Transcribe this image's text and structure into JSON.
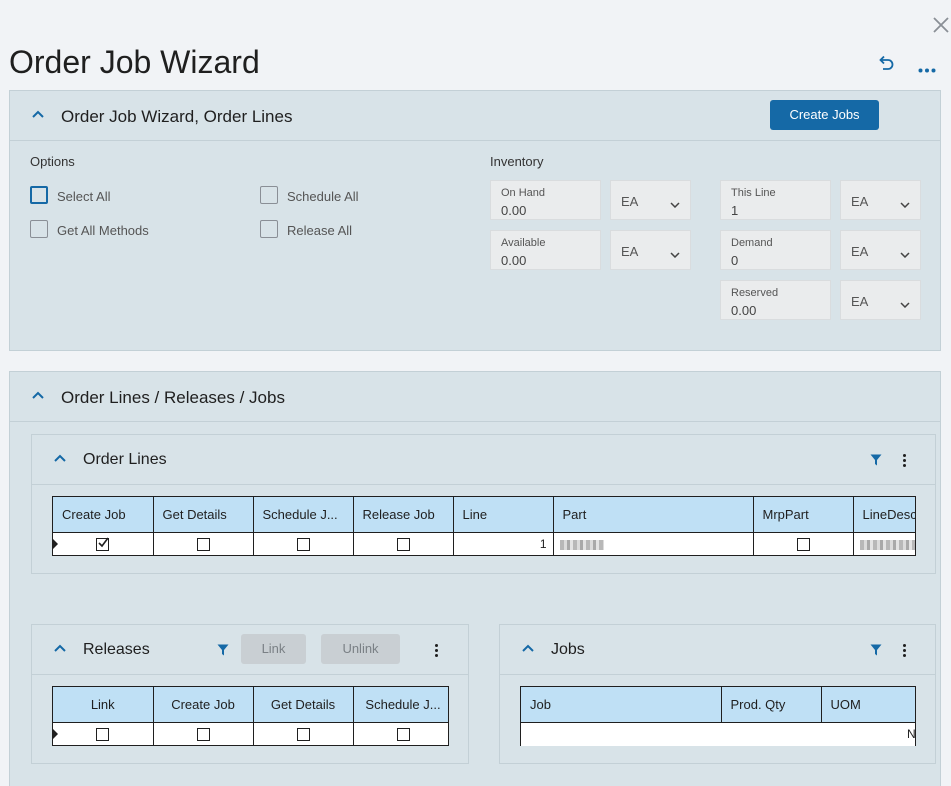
{
  "window": {
    "title": "Order Job Wizard"
  },
  "wizard_panel": {
    "title": "Order Job Wizard, Order Lines",
    "create_jobs_label": "Create Jobs",
    "options": {
      "heading": "Options",
      "select_all": "Select All",
      "schedule_all": "Schedule All",
      "get_all_methods": "Get All Methods",
      "release_all": "Release All"
    },
    "inventory": {
      "heading": "Inventory",
      "on_hand": {
        "label": "On Hand",
        "value": "0.00",
        "uom": "EA"
      },
      "available": {
        "label": "Available",
        "value": "0.00",
        "uom": "EA"
      },
      "this_line": {
        "label": "This Line",
        "value": "1",
        "uom": "EA"
      },
      "demand": {
        "label": "Demand",
        "value": "0",
        "uom": "EA"
      },
      "reserved": {
        "label": "Reserved",
        "value": "0.00",
        "uom": "EA"
      }
    }
  },
  "lines_panel": {
    "title": "Order Lines / Releases / Jobs",
    "order_lines": {
      "title": "Order Lines",
      "columns": [
        "Create Job",
        "Get Details",
        "Schedule J...",
        "Release Job",
        "Line",
        "Part",
        "MrpPart",
        "LineDesc"
      ],
      "row": {
        "line": "1"
      }
    },
    "releases": {
      "title": "Releases",
      "link_label": "Link",
      "unlink_label": "Unlink",
      "columns": [
        "Link",
        "Create Job",
        "Get Details",
        "Schedule J..."
      ]
    },
    "jobs": {
      "title": "Jobs",
      "columns": [
        "Job",
        "Prod. Qty",
        "UOM"
      ],
      "row_edge_text": "N"
    }
  },
  "colors": {
    "accent": "#1569a6",
    "panel": "#d8e3e8",
    "grid_header": "#bfe0f5"
  }
}
